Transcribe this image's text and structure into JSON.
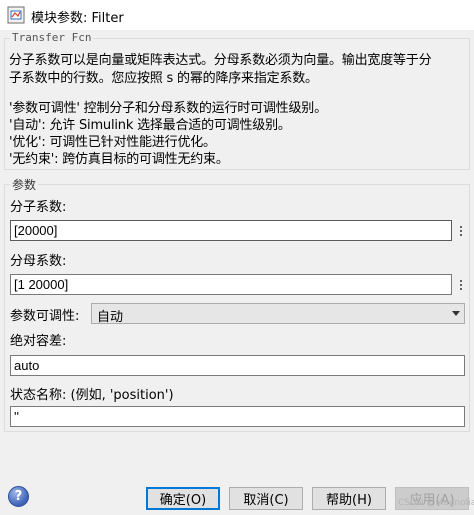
{
  "window": {
    "title": "模块参数: Filter"
  },
  "description": {
    "block_type": "Transfer Fcn",
    "lines": [
      "分子系数可以是向量或矩阵表达式。分母系数必须为向量。输出宽度等于分",
      "子系数中的行数。您应按照 s 的幂的降序来指定系数。",
      "'参数可调性' 控制分子和分母系数的运行时可调性级别。",
      "'自动': 允许 Simulink 选择最合适的可调性级别。",
      "'优化': 可调性已针对性能进行优化。",
      "'无约束': 跨仿真目标的可调性无约束。"
    ]
  },
  "params": {
    "section_title": "参数",
    "numerator": {
      "label": "分子系数:",
      "value": "[20000]"
    },
    "denominator": {
      "label": "分母系数:",
      "value": "[1 20000]"
    },
    "tunability": {
      "label": "参数可调性:",
      "selected": "自动"
    },
    "abs_tol": {
      "label": "绝对容差:",
      "value": "auto"
    },
    "state_name": {
      "label": "状态名称: (例如, 'position')",
      "value": "''"
    }
  },
  "buttons": {
    "ok": "确定(O)",
    "cancel": "取消(C)",
    "help": "帮助(H)",
    "apply": "应用(A)"
  },
  "watermark": "CSDN @Magnolia",
  "icons": {
    "app": "simulink-block-icon",
    "help": "help-icon"
  }
}
